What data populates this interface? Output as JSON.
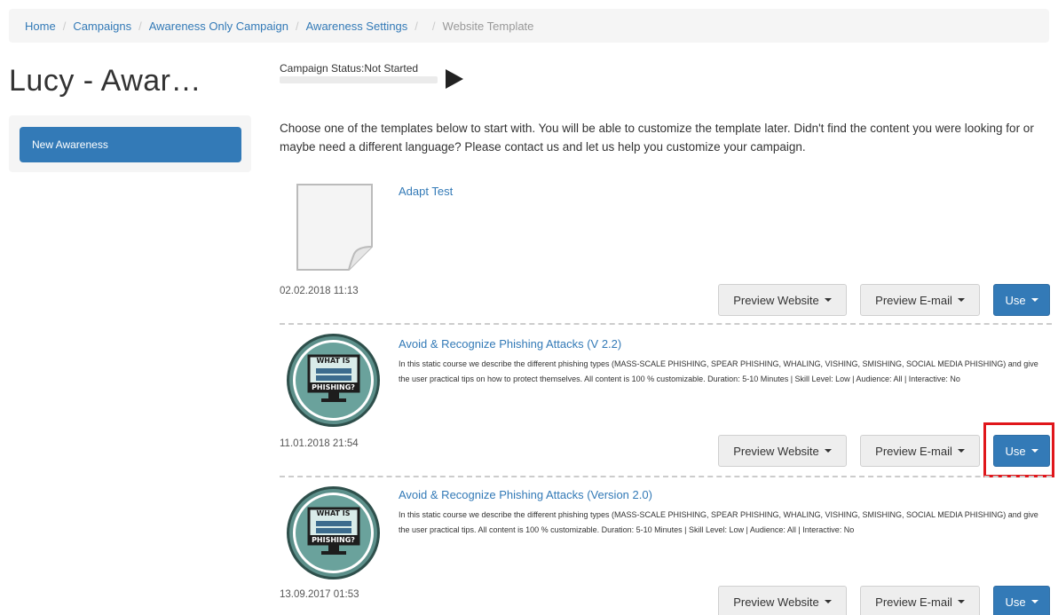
{
  "breadcrumb": {
    "items": [
      "Home",
      "Campaigns",
      "Awareness Only Campaign",
      "Awareness Settings",
      "Website Template"
    ],
    "separator": "/"
  },
  "page": {
    "title": "Lucy - Awar…"
  },
  "sidebar": {
    "new_awareness": "New Awareness"
  },
  "campaign": {
    "status_label": "Campaign Status:Not Started"
  },
  "intro": "Choose one of the templates below to start with. You will be able to customize the template later. Didn't find the content you were looking for or maybe need a different language? Please contact us and let us help you customize your campaign.",
  "templates": [
    {
      "title": "Adapt Test",
      "description": "",
      "date": "02.02.2018 11:13",
      "thumb": "document-icon"
    },
    {
      "title": "Avoid & Recognize Phishing Attacks (V 2.2)",
      "description": "In this static course we describe the different phishing types (MASS-SCALE PHISHING, SPEAR PHISHING, WHALING, VISHING, SMISHING, SOCIAL MEDIA PHISHING) and give the user practical tips on how to protect themselves. All content is 100 % customizable. Duration: 5-10 Minutes | Skill Level: Low | Audience: All | Interactive: No",
      "date": "11.01.2018 21:54",
      "thumb": "what-is-phishing-icon"
    },
    {
      "title": "Avoid & Recognize Phishing Attacks (Version 2.0)",
      "description": "In this static course we describe the different phishing types (MASS-SCALE PHISHING, SPEAR PHISHING, WHALING, VISHING, SMISHING, SOCIAL MEDIA PHISHING) and give the user practical tips. All content is 100 % customizable. Duration: 5-10 Minutes | Skill Level: Low | Audience: All | Interactive: No",
      "date": "13.09.2017 01:53",
      "thumb": "what-is-phishing-icon"
    }
  ],
  "buttons": {
    "preview_website": "Preview Website",
    "preview_email": "Preview E-mail",
    "use": "Use"
  },
  "thumb_text": {
    "line1": "WHAT IS",
    "line2": "PHISHING?"
  },
  "colors": {
    "accent": "#337ab7",
    "highlight": "#e0161b"
  }
}
